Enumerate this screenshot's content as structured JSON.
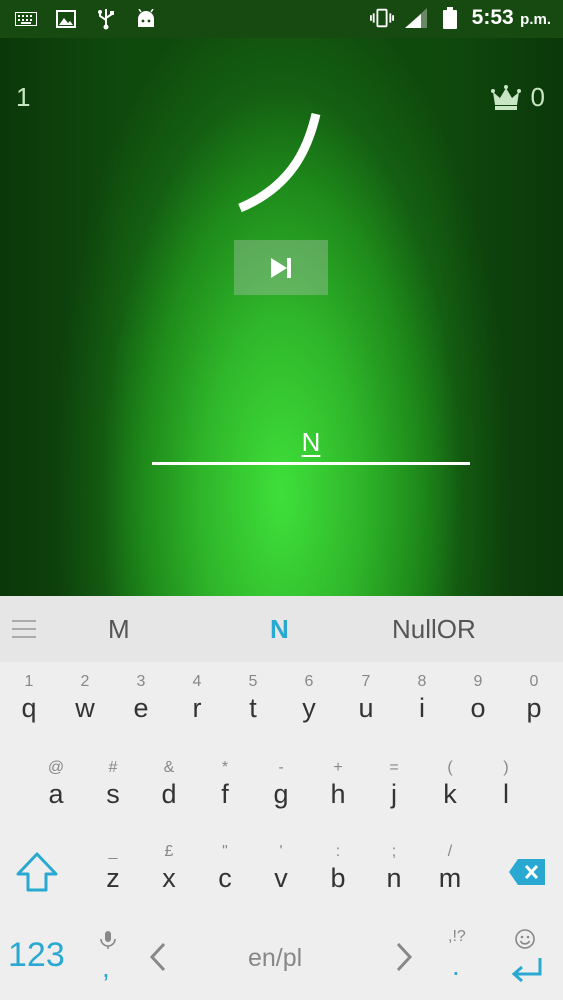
{
  "status_bar": {
    "time": "5:53",
    "ampm": "p.m.",
    "icons": [
      "keyboard-icon",
      "image-icon",
      "usb-icon",
      "android-icon",
      "vibrate-icon",
      "signal-icon",
      "battery-icon"
    ]
  },
  "game": {
    "level": "1",
    "score": "0",
    "answer": "N",
    "colors": {
      "bg_center": "#3fe03a",
      "bg_edge": "#0f4a0d",
      "skip_bg": "rgba(160,190,160,0.45)"
    }
  },
  "suggestions": [
    "M",
    "N",
    "NullOR"
  ],
  "keyboard": {
    "row1": [
      {
        "hint": "1",
        "key": "q"
      },
      {
        "hint": "2",
        "key": "w"
      },
      {
        "hint": "3",
        "key": "e"
      },
      {
        "hint": "4",
        "key": "r"
      },
      {
        "hint": "5",
        "key": "t"
      },
      {
        "hint": "6",
        "key": "y"
      },
      {
        "hint": "7",
        "key": "u"
      },
      {
        "hint": "8",
        "key": "i"
      },
      {
        "hint": "9",
        "key": "o"
      },
      {
        "hint": "0",
        "key": "p"
      }
    ],
    "row2": [
      {
        "hint": "@",
        "key": "a"
      },
      {
        "hint": "#",
        "key": "s"
      },
      {
        "hint": "&",
        "key": "d"
      },
      {
        "hint": "*",
        "key": "f"
      },
      {
        "hint": "-",
        "key": "g"
      },
      {
        "hint": "+",
        "key": "h"
      },
      {
        "hint": "=",
        "key": "j"
      },
      {
        "hint": "(",
        "key": "k"
      },
      {
        "hint": ")",
        "key": "l"
      }
    ],
    "row3": [
      {
        "hint": "_",
        "key": "z"
      },
      {
        "hint": "£",
        "key": "x"
      },
      {
        "hint": "\"",
        "key": "c"
      },
      {
        "hint": "'",
        "key": "v"
      },
      {
        "hint": ":",
        "key": "b"
      },
      {
        "hint": ";",
        "key": "n"
      },
      {
        "hint": "/",
        "key": "m"
      }
    ],
    "numbers_key": "123",
    "comma": ",",
    "language": "en/pl",
    "period_hint": ",!?",
    "period": ".",
    "accent_color": "#29a9d1"
  }
}
